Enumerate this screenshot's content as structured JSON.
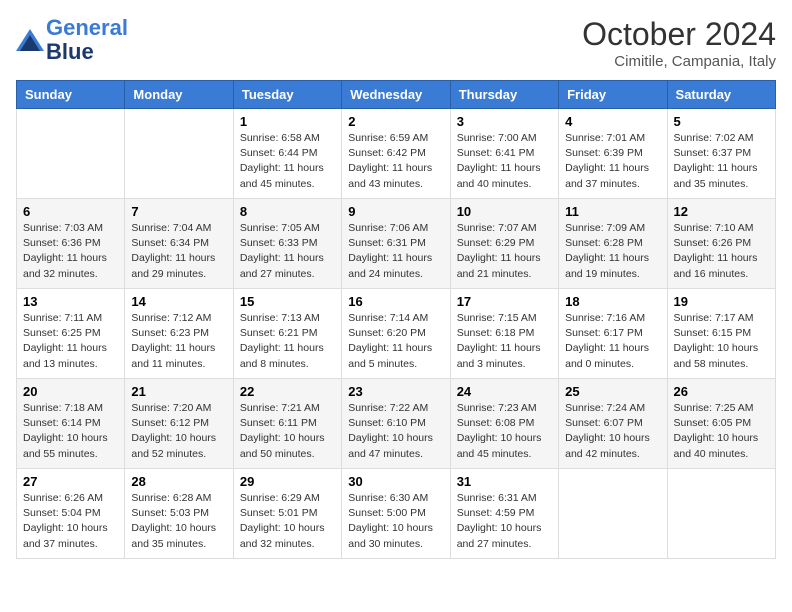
{
  "header": {
    "logo_line1": "General",
    "logo_line2": "Blue",
    "month": "October 2024",
    "location": "Cimitile, Campania, Italy"
  },
  "weekdays": [
    "Sunday",
    "Monday",
    "Tuesday",
    "Wednesday",
    "Thursday",
    "Friday",
    "Saturday"
  ],
  "weeks": [
    [
      {
        "day": "",
        "info": ""
      },
      {
        "day": "",
        "info": ""
      },
      {
        "day": "1",
        "info": "Sunrise: 6:58 AM\nSunset: 6:44 PM\nDaylight: 11 hours and 45 minutes."
      },
      {
        "day": "2",
        "info": "Sunrise: 6:59 AM\nSunset: 6:42 PM\nDaylight: 11 hours and 43 minutes."
      },
      {
        "day": "3",
        "info": "Sunrise: 7:00 AM\nSunset: 6:41 PM\nDaylight: 11 hours and 40 minutes."
      },
      {
        "day": "4",
        "info": "Sunrise: 7:01 AM\nSunset: 6:39 PM\nDaylight: 11 hours and 37 minutes."
      },
      {
        "day": "5",
        "info": "Sunrise: 7:02 AM\nSunset: 6:37 PM\nDaylight: 11 hours and 35 minutes."
      }
    ],
    [
      {
        "day": "6",
        "info": "Sunrise: 7:03 AM\nSunset: 6:36 PM\nDaylight: 11 hours and 32 minutes."
      },
      {
        "day": "7",
        "info": "Sunrise: 7:04 AM\nSunset: 6:34 PM\nDaylight: 11 hours and 29 minutes."
      },
      {
        "day": "8",
        "info": "Sunrise: 7:05 AM\nSunset: 6:33 PM\nDaylight: 11 hours and 27 minutes."
      },
      {
        "day": "9",
        "info": "Sunrise: 7:06 AM\nSunset: 6:31 PM\nDaylight: 11 hours and 24 minutes."
      },
      {
        "day": "10",
        "info": "Sunrise: 7:07 AM\nSunset: 6:29 PM\nDaylight: 11 hours and 21 minutes."
      },
      {
        "day": "11",
        "info": "Sunrise: 7:09 AM\nSunset: 6:28 PM\nDaylight: 11 hours and 19 minutes."
      },
      {
        "day": "12",
        "info": "Sunrise: 7:10 AM\nSunset: 6:26 PM\nDaylight: 11 hours and 16 minutes."
      }
    ],
    [
      {
        "day": "13",
        "info": "Sunrise: 7:11 AM\nSunset: 6:25 PM\nDaylight: 11 hours and 13 minutes."
      },
      {
        "day": "14",
        "info": "Sunrise: 7:12 AM\nSunset: 6:23 PM\nDaylight: 11 hours and 11 minutes."
      },
      {
        "day": "15",
        "info": "Sunrise: 7:13 AM\nSunset: 6:21 PM\nDaylight: 11 hours and 8 minutes."
      },
      {
        "day": "16",
        "info": "Sunrise: 7:14 AM\nSunset: 6:20 PM\nDaylight: 11 hours and 5 minutes."
      },
      {
        "day": "17",
        "info": "Sunrise: 7:15 AM\nSunset: 6:18 PM\nDaylight: 11 hours and 3 minutes."
      },
      {
        "day": "18",
        "info": "Sunrise: 7:16 AM\nSunset: 6:17 PM\nDaylight: 11 hours and 0 minutes."
      },
      {
        "day": "19",
        "info": "Sunrise: 7:17 AM\nSunset: 6:15 PM\nDaylight: 10 hours and 58 minutes."
      }
    ],
    [
      {
        "day": "20",
        "info": "Sunrise: 7:18 AM\nSunset: 6:14 PM\nDaylight: 10 hours and 55 minutes."
      },
      {
        "day": "21",
        "info": "Sunrise: 7:20 AM\nSunset: 6:12 PM\nDaylight: 10 hours and 52 minutes."
      },
      {
        "day": "22",
        "info": "Sunrise: 7:21 AM\nSunset: 6:11 PM\nDaylight: 10 hours and 50 minutes."
      },
      {
        "day": "23",
        "info": "Sunrise: 7:22 AM\nSunset: 6:10 PM\nDaylight: 10 hours and 47 minutes."
      },
      {
        "day": "24",
        "info": "Sunrise: 7:23 AM\nSunset: 6:08 PM\nDaylight: 10 hours and 45 minutes."
      },
      {
        "day": "25",
        "info": "Sunrise: 7:24 AM\nSunset: 6:07 PM\nDaylight: 10 hours and 42 minutes."
      },
      {
        "day": "26",
        "info": "Sunrise: 7:25 AM\nSunset: 6:05 PM\nDaylight: 10 hours and 40 minutes."
      }
    ],
    [
      {
        "day": "27",
        "info": "Sunrise: 6:26 AM\nSunset: 5:04 PM\nDaylight: 10 hours and 37 minutes."
      },
      {
        "day": "28",
        "info": "Sunrise: 6:28 AM\nSunset: 5:03 PM\nDaylight: 10 hours and 35 minutes."
      },
      {
        "day": "29",
        "info": "Sunrise: 6:29 AM\nSunset: 5:01 PM\nDaylight: 10 hours and 32 minutes."
      },
      {
        "day": "30",
        "info": "Sunrise: 6:30 AM\nSunset: 5:00 PM\nDaylight: 10 hours and 30 minutes."
      },
      {
        "day": "31",
        "info": "Sunrise: 6:31 AM\nSunset: 4:59 PM\nDaylight: 10 hours and 27 minutes."
      },
      {
        "day": "",
        "info": ""
      },
      {
        "day": "",
        "info": ""
      }
    ]
  ]
}
